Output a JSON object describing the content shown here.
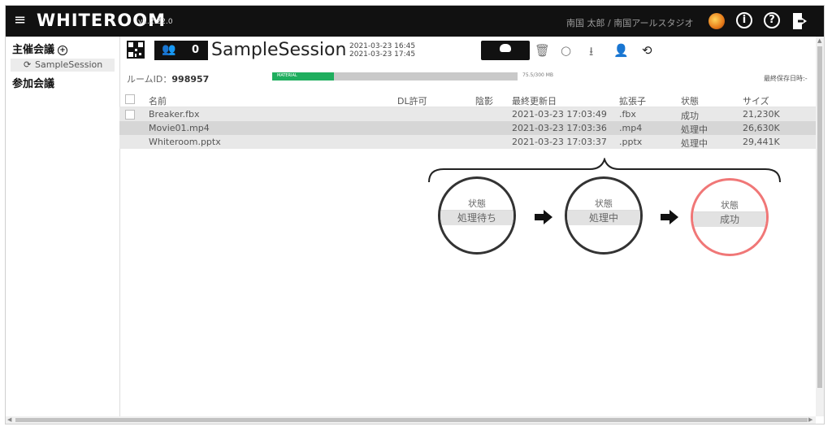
{
  "app": {
    "logo": "WHITEROOM",
    "version": "v1.2.22.0",
    "user": "南国 太郎 / 南国アールスタジオ"
  },
  "icons": {
    "menu": "hamburger-menu-icon",
    "info": "info-icon",
    "help": "help-icon",
    "logout": "logout-icon",
    "avatar": "planet-avatar-icon"
  },
  "sidebar": {
    "host_label": "主催会議",
    "host_add": "+",
    "session_item": "SampleSession",
    "join_label": "参加会議"
  },
  "session": {
    "participants": "0",
    "title": "SampleSession",
    "created": "2021-03-23 16:45",
    "updated": "2021-03-23 17:45",
    "room_id_label": "ルームID：",
    "room_id": "998957",
    "storage_label": "MATERIAL",
    "storage_text": "75.5/300 MB",
    "storage_fraction": 0.25,
    "last_saved": "最終保存日時:-"
  },
  "table": {
    "headers": {
      "name": "名前",
      "dl": "DL許可",
      "shadow": "陰影",
      "date": "最終更新日",
      "ext": "拡張子",
      "status": "状態",
      "size": "サイズ"
    },
    "rows": [
      {
        "name": "Breaker.fbx",
        "date": "2021-03-23 17:03:49",
        "ext": ".fbx",
        "status": "成功",
        "size": "21,230K"
      },
      {
        "name": "Movie01.mp4",
        "date": "2021-03-23 17:03:36",
        "ext": ".mp4",
        "status": "処理中",
        "size": "26,630K"
      },
      {
        "name": "Whiteroom.pptx",
        "date": "2021-03-23 17:03:37",
        "ext": ".pptx",
        "status": "処理中",
        "size": "29,441K"
      }
    ]
  },
  "diagram": {
    "steps": [
      {
        "header": "状態",
        "value": "処理待ち"
      },
      {
        "header": "状態",
        "value": "処理中"
      },
      {
        "header": "状態",
        "value": "成功"
      }
    ],
    "colors": {
      "normal": "#333333",
      "success": "#f07777"
    }
  }
}
